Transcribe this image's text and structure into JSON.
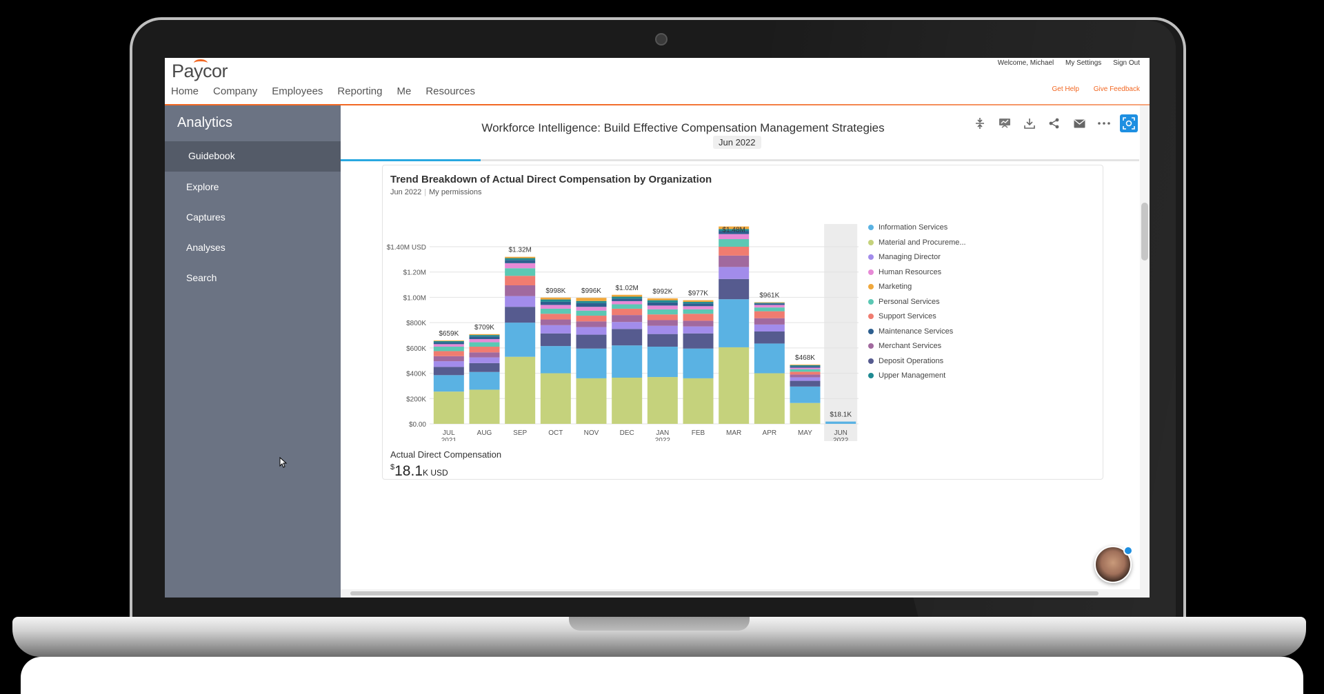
{
  "header": {
    "logo": "Paycor",
    "nav": [
      "Home",
      "Company",
      "Employees",
      "Reporting",
      "Me",
      "Resources"
    ],
    "welcome": "Welcome, Michael",
    "my_settings": "My Settings",
    "sign_out": "Sign Out",
    "get_help": "Get Help",
    "give_feedback": "Give Feedback"
  },
  "sidebar": {
    "title": "Analytics",
    "items": [
      {
        "label": "Guidebook",
        "active": true
      },
      {
        "label": "Explore"
      },
      {
        "label": "Captures"
      },
      {
        "label": "Analyses"
      },
      {
        "label": "Search"
      }
    ]
  },
  "report": {
    "title": "Workforce Intelligence: Build Effective Compensation Management Strategies",
    "date_chip": "Jun 2022",
    "progress_fraction": 0.175,
    "toolbar_icons": [
      "collapse-icon",
      "presentation-icon",
      "download-icon",
      "share-icon",
      "mail-icon",
      "more-icon",
      "capture-icon"
    ]
  },
  "card": {
    "title": "Trend Breakdown of Actual Direct Compensation by Organization",
    "period": "Jun 2022",
    "scope": "My permissions",
    "kpi_label": "Actual Direct Compensation",
    "kpi_currency": "$",
    "kpi_value": "18.1",
    "kpi_unit": "K USD"
  },
  "chart_data": {
    "type": "bar",
    "stacked": true,
    "title": "Trend Breakdown of Actual Direct Compensation by Organization",
    "categories": [
      "JUL 2021",
      "AUG",
      "SEP",
      "OCT",
      "NOV",
      "DEC",
      "JAN 2022",
      "FEB",
      "MAR",
      "APR",
      "MAY",
      "JUN 2022"
    ],
    "category_lines": [
      [
        "JUL",
        "2021"
      ],
      [
        "AUG",
        ""
      ],
      [
        "SEP",
        ""
      ],
      [
        "OCT",
        ""
      ],
      [
        "NOV",
        ""
      ],
      [
        "DEC",
        ""
      ],
      [
        "JAN",
        "2022"
      ],
      [
        "FEB",
        ""
      ],
      [
        "MAR",
        ""
      ],
      [
        "APR",
        ""
      ],
      [
        "MAY",
        ""
      ],
      [
        "JUN",
        "2022"
      ]
    ],
    "totals": [
      659000,
      709000,
      1320000,
      998000,
      996000,
      1020000,
      992000,
      977000,
      1480000,
      961000,
      468000,
      18100
    ],
    "total_labels": [
      "$659K",
      "$709K",
      "$1.32M",
      "$998K",
      "$996K",
      "$1.02M",
      "$992K",
      "$977K",
      "$1.48M",
      "$961K",
      "$468K",
      "$18.1K"
    ],
    "highlight_category": "JUN 2022",
    "ylim": [
      0,
      1400000
    ],
    "yticks": [
      0,
      200000,
      400000,
      600000,
      800000,
      1000000,
      1200000,
      1400000
    ],
    "ytick_labels": [
      "$0.00",
      "$200K",
      "$400K",
      "$600K",
      "$800K",
      "$1.00M",
      "$1.20M",
      "$1.40M USD"
    ],
    "grid": true,
    "legend_position": "right",
    "series": [
      {
        "name": "Material and Procureme...",
        "color": "#c5d27c",
        "values": [
          255000,
          270000,
          530000,
          400000,
          360000,
          365000,
          370000,
          360000,
          605000,
          400000,
          165000,
          0
        ]
      },
      {
        "name": "Information Services",
        "color": "#5ab2e3",
        "values": [
          130000,
          140000,
          270000,
          215000,
          235000,
          255000,
          240000,
          235000,
          380000,
          235000,
          130000,
          18100
        ]
      },
      {
        "name": "Deposit Operations",
        "color": "#565b8f",
        "values": [
          65000,
          70000,
          125000,
          100000,
          110000,
          130000,
          100000,
          120000,
          160000,
          95000,
          45000,
          0
        ]
      },
      {
        "name": "Managing Director",
        "color": "#a28ceb",
        "values": [
          45000,
          45000,
          85000,
          65000,
          60000,
          55000,
          65000,
          55000,
          95000,
          55000,
          28000,
          0
        ]
      },
      {
        "name": "Merchant Services",
        "color": "#a1699e",
        "values": [
          40000,
          40000,
          85000,
          45000,
          45000,
          55000,
          45000,
          45000,
          90000,
          50000,
          22000,
          0
        ]
      },
      {
        "name": "Support Services",
        "color": "#f07c70",
        "values": [
          40000,
          45000,
          75000,
          45000,
          45000,
          50000,
          45000,
          55000,
          70000,
          55000,
          22000,
          0
        ]
      },
      {
        "name": "Personal Services",
        "color": "#5bc8b4",
        "values": [
          35000,
          35000,
          60000,
          40000,
          40000,
          35000,
          40000,
          35000,
          60000,
          30000,
          20000,
          0
        ]
      },
      {
        "name": "Human Resources",
        "color": "#e78ad6",
        "values": [
          20000,
          25000,
          40000,
          30000,
          30000,
          25000,
          30000,
          25000,
          40000,
          20000,
          12000,
          0
        ]
      },
      {
        "name": "Maintenance Services",
        "color": "#2d5f8f",
        "values": [
          15000,
          20000,
          25000,
          25000,
          30000,
          20000,
          25000,
          22000,
          25000,
          12000,
          12000,
          0
        ]
      },
      {
        "name": "Upper Management",
        "color": "#1f8a92",
        "values": [
          9000,
          12000,
          15000,
          18000,
          16000,
          15000,
          17000,
          12000,
          15000,
          5000,
          7000,
          0
        ]
      },
      {
        "name": "Marketing",
        "color": "#f0a83c",
        "values": [
          5000,
          7000,
          10000,
          15000,
          25000,
          15000,
          15000,
          13000,
          20000,
          4000,
          5000,
          0
        ]
      }
    ],
    "legend_order": [
      "Information Services",
      "Material and Procureme...",
      "Managing Director",
      "Human Resources",
      "Marketing",
      "Personal Services",
      "Support Services",
      "Maintenance Services",
      "Merchant Services",
      "Deposit Operations",
      "Upper Management"
    ]
  }
}
